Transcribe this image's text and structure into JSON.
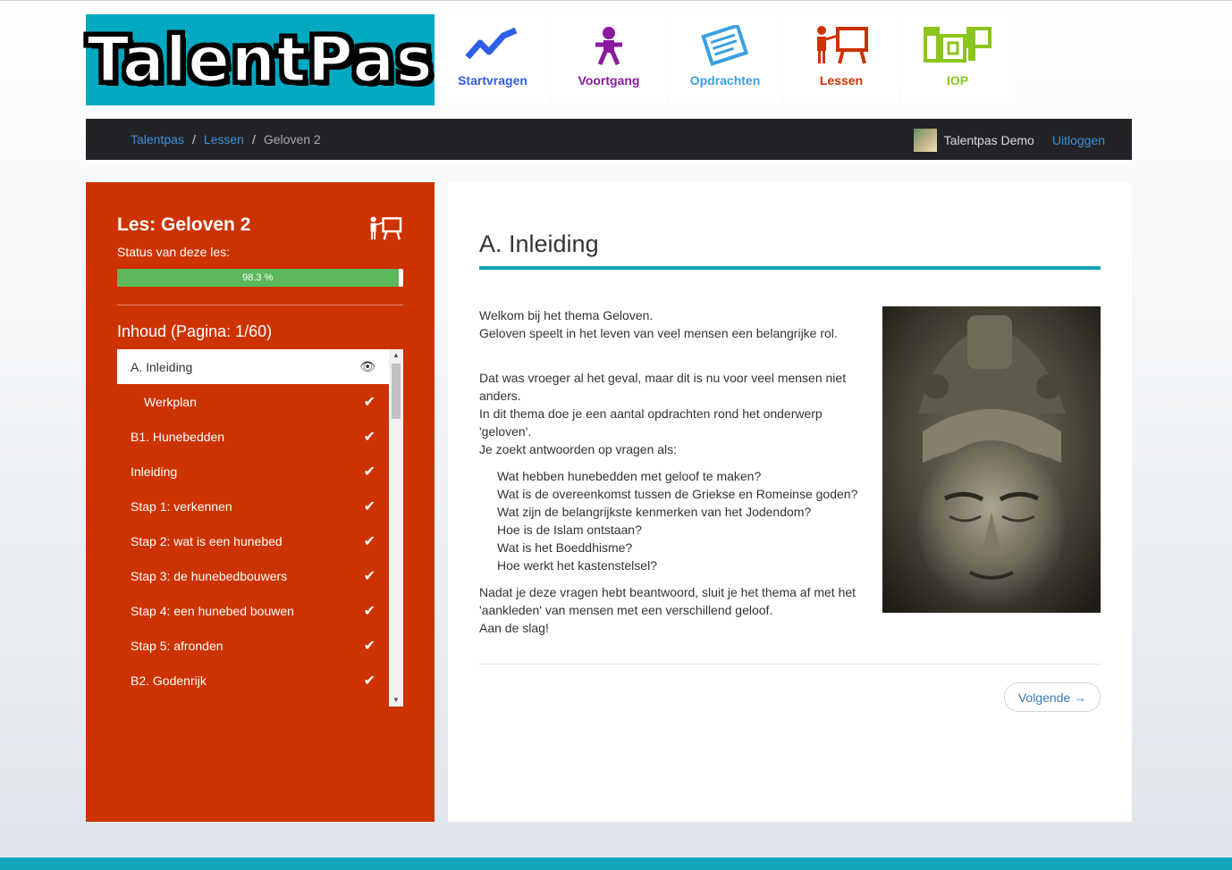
{
  "brand": {
    "logo_text": "TalentPas"
  },
  "nav": [
    {
      "label": "Startvragen",
      "color": "#2e5ee6",
      "icon": "chart-trend-icon"
    },
    {
      "label": "Voortgang",
      "color": "#8a1a9e",
      "icon": "person-icon"
    },
    {
      "label": "Opdrachten",
      "color": "#3aa0e0",
      "icon": "assignment-icon"
    },
    {
      "label": "Lessen",
      "color": "#cc3300",
      "icon": "teacher-board-icon"
    },
    {
      "label": "IOP",
      "color": "#8cc41e",
      "icon": "iop-icon"
    }
  ],
  "breadcrumb": {
    "home": "Talentpas",
    "section": "Lessen",
    "current": "Geloven 2",
    "separator": "/"
  },
  "user": {
    "name": "Talentpas Demo",
    "logout": "Uitloggen"
  },
  "sidebar": {
    "title": "Les: Geloven 2",
    "status_label": "Status van deze les:",
    "progress_text": "98.3 %",
    "progress_value": 98.3,
    "toc_title": "Inhoud (Pagina: 1/60)",
    "items": [
      {
        "label": "A. Inleiding",
        "active": true,
        "indent": false,
        "icon": "eye-icon"
      },
      {
        "label": "Werkplan",
        "active": false,
        "indent": true,
        "icon": "check-icon"
      },
      {
        "label": "B1. Hunebedden",
        "active": false,
        "indent": false,
        "icon": "check-icon"
      },
      {
        "label": "Inleiding",
        "active": false,
        "indent": false,
        "icon": "check-icon"
      },
      {
        "label": "Stap 1: verkennen",
        "active": false,
        "indent": false,
        "icon": "check-icon"
      },
      {
        "label": "Stap 2: wat is een hunebed",
        "active": false,
        "indent": false,
        "icon": "check-icon"
      },
      {
        "label": "Stap 3: de hunebedbouwers",
        "active": false,
        "indent": false,
        "icon": "check-icon"
      },
      {
        "label": "Stap 4: een hunebed bouwen",
        "active": false,
        "indent": false,
        "icon": "check-icon"
      },
      {
        "label": "Stap 5: afronden",
        "active": false,
        "indent": false,
        "icon": "check-icon"
      },
      {
        "label": "B2. Godenrijk",
        "active": false,
        "indent": false,
        "icon": "check-icon"
      }
    ]
  },
  "main": {
    "heading": "A. Inleiding",
    "intro": [
      "Welkom bij het thema Geloven.",
      "Geloven speelt in het leven van veel mensen een belangrijke rol."
    ],
    "para": [
      "Dat was vroeger al het geval, maar dit is nu voor veel mensen niet anders.",
      "In dit thema doe je een aantal opdrachten rond het onderwerp 'geloven'.",
      "Je zoekt antwoorden op vragen als:"
    ],
    "questions": [
      "Wat hebben hunebedden met geloof te maken?",
      "Wat is de overeenkomst tussen de Griekse en Romeinse goden?",
      "Wat zijn de belangrijkste kenmerken van het Jodendom?",
      "Hoe is de Islam ontstaan?",
      "Wat is het Boeddhisme?",
      "Hoe werkt het kastenstelsel?"
    ],
    "outro": [
      "Nadat je deze vragen hebt beantwoord, sluit je het thema af met het 'aankleden' van mensen met een verschillend geloof.",
      "Aan de slag!"
    ],
    "next_button": "Volgende →"
  },
  "colors": {
    "teal": "#00a9c1",
    "orange_red": "#cc3300",
    "green": "#5cb85c",
    "link": "#3f8fd8"
  }
}
